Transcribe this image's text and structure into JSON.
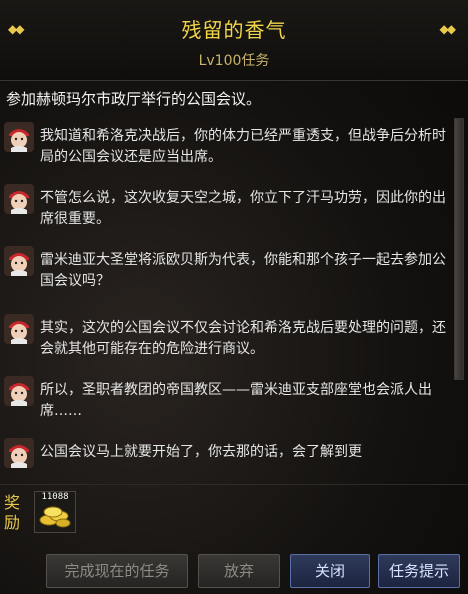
{
  "quest": {
    "title": "残留的香气",
    "level": "Lv100任务",
    "objective": "参加赫顿玛尔市政厅举行的公国会议。"
  },
  "dialog": [
    {
      "text": "我知道和希洛克决战后，你的体力已经严重透支，但战争后分析时局的公国会议还是应当出席。"
    },
    {
      "text": "不管怎么说，这次收复天空之城，你立下了汗马功劳，因此你的出席很重要。"
    },
    {
      "text": "雷米迪亚大圣堂将派欧贝斯为代表，你能和那个孩子一起去参加公国会议吗？"
    },
    {
      "text": "其实，这次的公国会议不仅会讨论和希洛克战后要处理的问题，还会就其他可能存在的危险进行商议。"
    },
    {
      "text": "所以，圣职者教团的帝国教区——雷米迪亚支部座堂也会派人出席……"
    },
    {
      "text": "公国会议马上就要开始了，你去那的话，会了解到更"
    }
  ],
  "reward": {
    "label": "奖励",
    "item_count": "11088",
    "item_icon": "gold-coins-icon"
  },
  "buttons": {
    "complete": "完成现在的任务",
    "abandon": "放弃",
    "close": "关闭",
    "hint": "任务提示"
  },
  "colors": {
    "title": "#f2d64a",
    "accent_button": "#2f3a5a"
  }
}
